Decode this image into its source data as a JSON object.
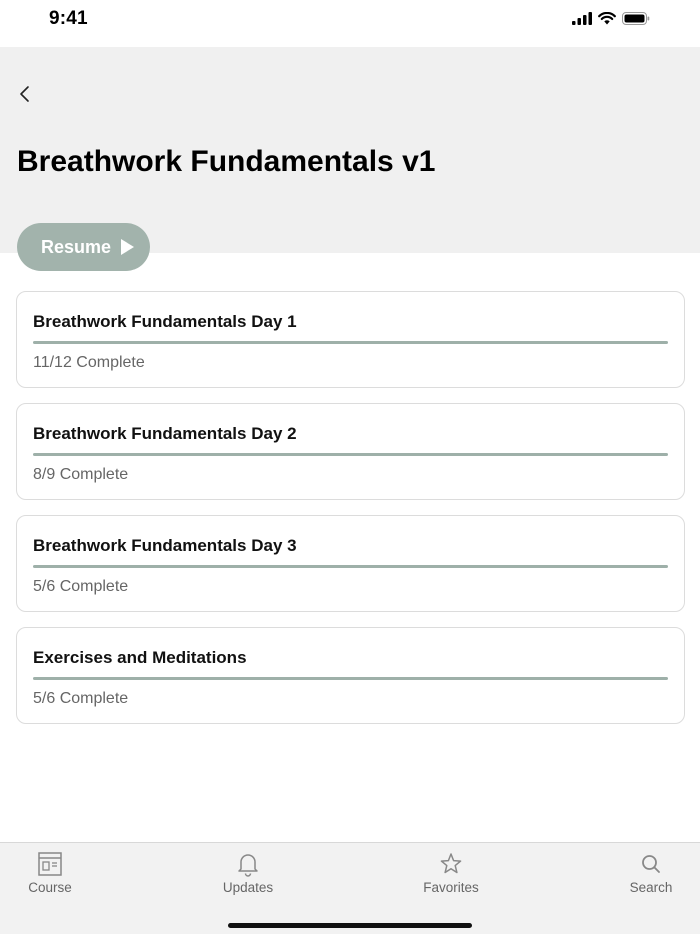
{
  "status_bar": {
    "time": "9:41"
  },
  "header": {
    "title": "Breathwork Fundamentals v1"
  },
  "resume_button": {
    "label": "Resume"
  },
  "lessons": [
    {
      "title": "Breathwork Fundamentals Day 1",
      "status": "11/12 Complete",
      "progress": 1.0
    },
    {
      "title": "Breathwork Fundamentals Day 2",
      "status": "8/9 Complete",
      "progress": 1.0
    },
    {
      "title": "Breathwork Fundamentals Day 3",
      "status": "5/6 Complete",
      "progress": 1.0
    },
    {
      "title": "Exercises and Meditations",
      "status": "5/6 Complete",
      "progress": 1.0
    }
  ],
  "tab_bar": {
    "tabs": [
      {
        "label": "Course",
        "icon": "course-icon"
      },
      {
        "label": "Updates",
        "icon": "bell-icon"
      },
      {
        "label": "Favorites",
        "icon": "star-icon"
      },
      {
        "label": "Search",
        "icon": "search-icon"
      }
    ]
  },
  "colors": {
    "accent": "#a2b3ac",
    "progress": "#9eb0a9",
    "header_bg": "#f0f0f0"
  }
}
